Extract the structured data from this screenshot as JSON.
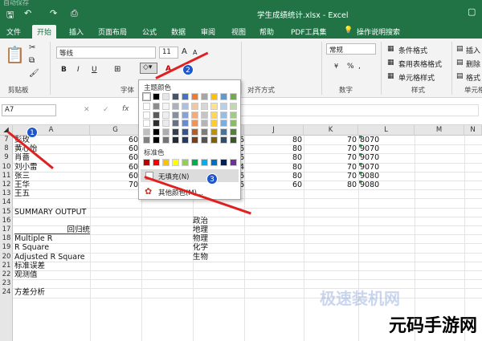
{
  "window": {
    "title": "学生成绩统计.xlsx  -  Excel",
    "top_left_text": "自动保存"
  },
  "tabs": [
    "文件",
    "开始",
    "插入",
    "页面布局",
    "公式",
    "数据",
    "审阅",
    "视图",
    "帮助",
    "PDF工具集",
    "操作说明搜索"
  ],
  "active_tab": "开始",
  "ribbon": {
    "font_name": "等线",
    "font_size": "11",
    "number_format": "常规",
    "cond_format": "条件格式",
    "table_format": "套用表格格式",
    "cell_style": "单元格样式",
    "insert": "插入",
    "delete": "删除",
    "format": "格式",
    "percent": "%",
    "thousands": ",",
    "groups": {
      "clipboard": "剪贴板",
      "font": "字体",
      "align": "对齐方式",
      "number": "数字",
      "styles": "样式",
      "cells": "单元格"
    },
    "bold": "B",
    "italic": "I",
    "underline": "U",
    "font_a_big": "A",
    "font_a_small": "A"
  },
  "name_box": "A7",
  "formula_fx": "fx",
  "columns": [
    "A",
    "G",
    "H",
    "I",
    "J",
    "K",
    "L",
    "M",
    "N"
  ],
  "rows": [
    "7",
    "8",
    "9",
    "10",
    "11",
    "12",
    "13",
    "14",
    "15",
    "16",
    "17",
    "18",
    "19",
    "20",
    "21",
    "22",
    "23",
    "24"
  ],
  "col_a_values": [
    "彭玫",
    "黄心怡",
    "肖蔷",
    "刘小雷",
    "张三",
    "王华",
    "王五",
    "",
    "SUMMARY OUTPUT",
    "",
    "回归统",
    "Multiple R",
    "R Square",
    "Adjusted R Square",
    "标准误差",
    "观测值",
    "",
    "方差分析"
  ],
  "col_g_values": [
    "60",
    "60",
    "60",
    "60",
    "60",
    "70"
  ],
  "col_i_values": [
    "6",
    "6",
    "6",
    "4",
    "6",
    "6"
  ],
  "col_j_values": [
    "80",
    "80",
    "80",
    "80",
    "80",
    "60"
  ],
  "col_k_values": [
    "70",
    "70",
    "70",
    "70",
    "70",
    "80"
  ],
  "col_l_values": [
    "8070",
    "9070",
    "9070",
    "9070",
    "9080",
    "9080"
  ],
  "subjects": [
    "政治",
    "地理",
    "物理",
    "化学",
    "生物"
  ],
  "palette": {
    "theme_label": "主题颜色",
    "standard_label": "标准色",
    "no_fill": "无填充(N)",
    "more_colors": "其他颜色(M)...",
    "theme_colors": [
      "#ffffff",
      "#000000",
      "#e7e6e6",
      "#44546a",
      "#4472c4",
      "#ed7d31",
      "#a5a5a5",
      "#ffc000",
      "#5b9bd5",
      "#70ad47"
    ],
    "standard_colors": [
      "#c00000",
      "#ff0000",
      "#ffc000",
      "#ffff00",
      "#92d050",
      "#00b050",
      "#00b0f0",
      "#0070c0",
      "#002060",
      "#7030a0"
    ]
  },
  "badges": [
    "1",
    "2",
    "3"
  ],
  "watermark": {
    "text": "元码手游网",
    "faint": "极速装机网"
  }
}
